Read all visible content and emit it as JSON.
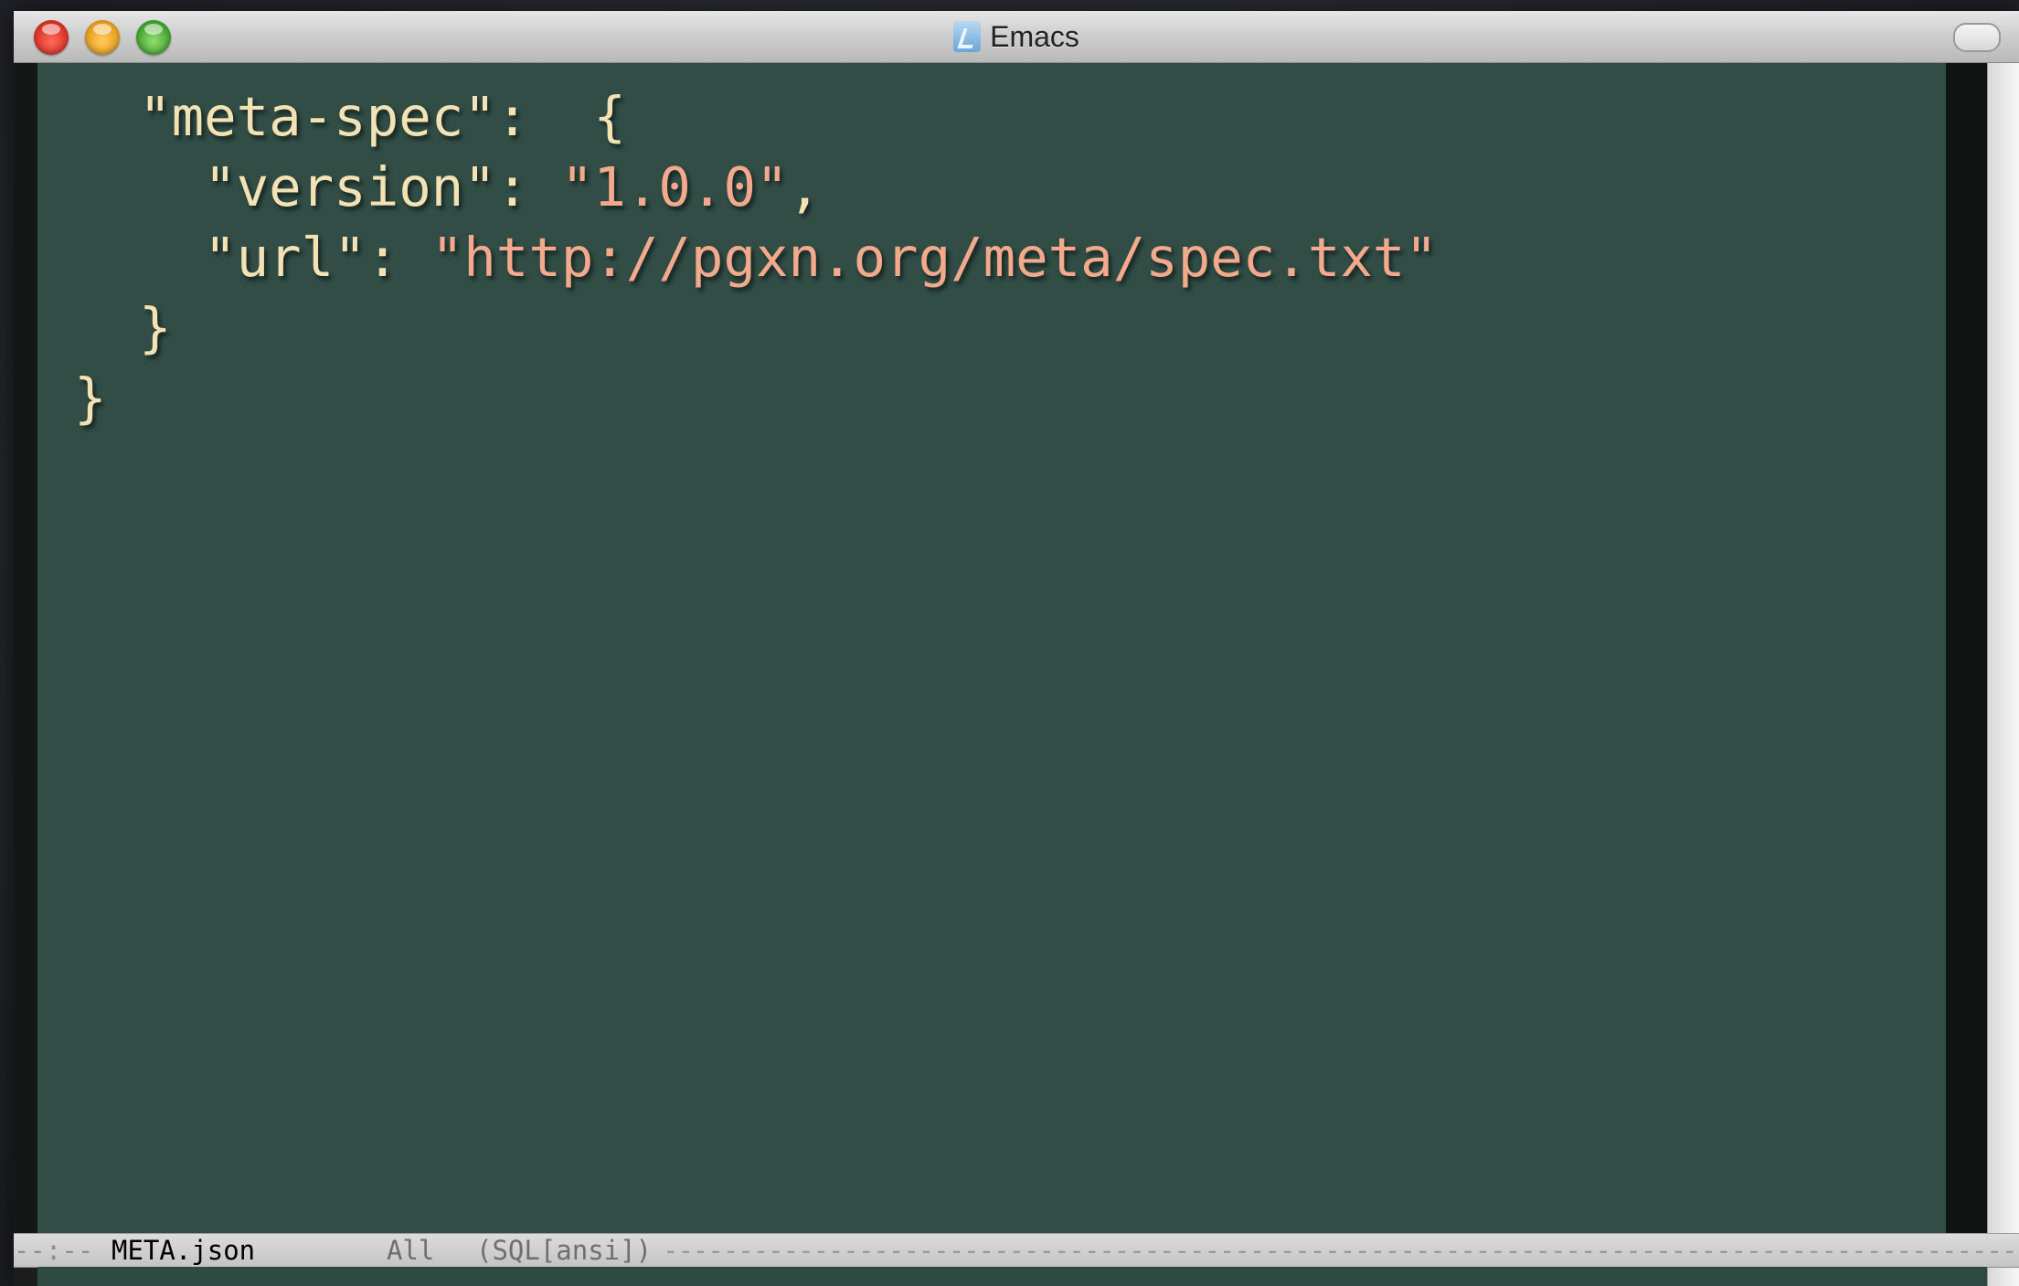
{
  "window": {
    "title": "Emacs",
    "title_icon": "emacs-app-icon",
    "buttons": [
      "close-icon",
      "minimize-icon",
      "zoom-icon"
    ]
  },
  "editor": {
    "colors": {
      "background": "#314d46",
      "punctuation": "#f3e2b3",
      "string": "#f2a98c"
    },
    "lines": [
      [
        {
          "t": "  ",
          "c": "punct"
        },
        {
          "t": "\"meta-spec\"",
          "c": "punct"
        },
        {
          "t": ":  {",
          "c": "punct"
        }
      ],
      [
        {
          "t": "    ",
          "c": "punct"
        },
        {
          "t": "\"version\"",
          "c": "punct"
        },
        {
          "t": ": ",
          "c": "punct"
        },
        {
          "t": "\"1.0.0\"",
          "c": "str"
        },
        {
          "t": ",",
          "c": "punct"
        }
      ],
      [
        {
          "t": "    ",
          "c": "punct"
        },
        {
          "t": "\"url\"",
          "c": "punct"
        },
        {
          "t": ": ",
          "c": "punct"
        },
        {
          "t": "\"http://pgxn.org/meta/spec.txt\"",
          "c": "str"
        }
      ],
      [
        {
          "t": "  }",
          "c": "punct"
        }
      ],
      [
        {
          "t": "}",
          "c": "punct"
        }
      ]
    ]
  },
  "modeline": {
    "status": "--:--",
    "buffer_name": "META.json",
    "position": "All",
    "mode": "(SQL[ansi])",
    "dashes": "----------------------------------------------------------------------------------------------------------------------------------------"
  }
}
